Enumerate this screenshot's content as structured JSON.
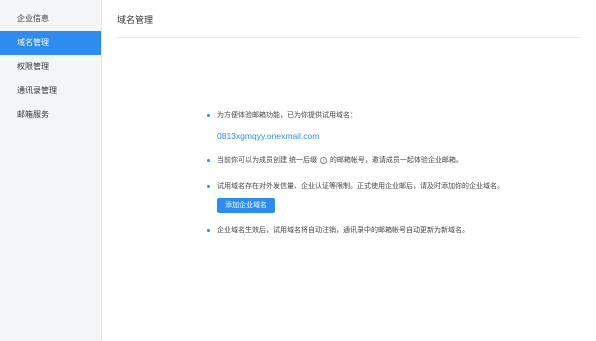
{
  "sidebar": {
    "items": [
      {
        "label": "企业信息"
      },
      {
        "label": "域名管理"
      },
      {
        "label": "权限管理"
      },
      {
        "label": "通讯录管理"
      },
      {
        "label": "邮箱服务"
      }
    ],
    "active_index": 1
  },
  "main": {
    "title": "域名管理",
    "notes": {
      "provided_prefix": "为方便体验邮箱功能，已为你提供试用域名：",
      "trial_domain": "0813xgmqyy.onexmail.com",
      "create_before": "当前你可以为成员创建 统一后缀",
      "create_after": "的邮箱帐号，邀请成员一起体验企业邮箱。",
      "limit_text": "试用域名存在对外发信量、企业认证等限制。正式使用企业邮后，请及时添加你的企业域名。",
      "add_button_label": "添加企业域名",
      "effect_text": "企业域名生效后，试用域名将自动注销，通讯录中的邮箱帐号自动更新为新域名。"
    },
    "info_icon_glyph": "i"
  },
  "colors": {
    "accent": "#2d8cf0",
    "sidebar_bg": "#f4f5f7"
  }
}
